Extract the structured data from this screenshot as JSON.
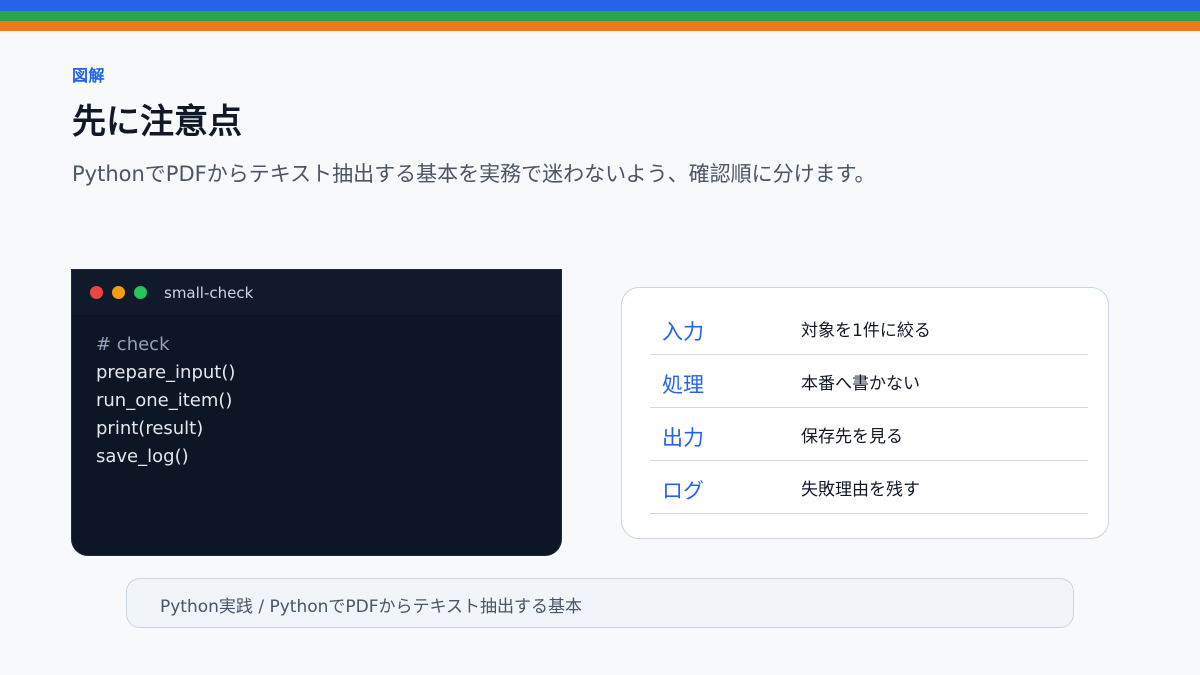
{
  "colors": {
    "stripe_blue": "#2563eb",
    "stripe_green": "#2ca54a",
    "stripe_orange": "#f0771a",
    "accent": "#2563eb",
    "dot_red": "#ef4444",
    "dot_yellow": "#f59e0b",
    "dot_green": "#22c55e"
  },
  "header": {
    "eyebrow": "図解",
    "title": "先に注意点",
    "subtitle": "PythonでPDFからテキスト抽出する基本を実務で迷わないよう、確認順に分けます。"
  },
  "terminal": {
    "title": "small-check",
    "window_controls": [
      "close-dot",
      "minimize-dot",
      "maximize-dot"
    ],
    "lines": [
      "# check",
      "prepare_input()",
      "run_one_item()",
      "print(result)",
      "save_log()"
    ]
  },
  "checklist": {
    "rows": [
      {
        "label": "入力",
        "value": "対象を1件に絞る"
      },
      {
        "label": "処理",
        "value": "本番へ書かない"
      },
      {
        "label": "出力",
        "value": "保存先を見る"
      },
      {
        "label": "ログ",
        "value": "失敗理由を残す"
      }
    ]
  },
  "footer": {
    "breadcrumb": "Python実践 / PythonでPDFからテキスト抽出する基本"
  }
}
